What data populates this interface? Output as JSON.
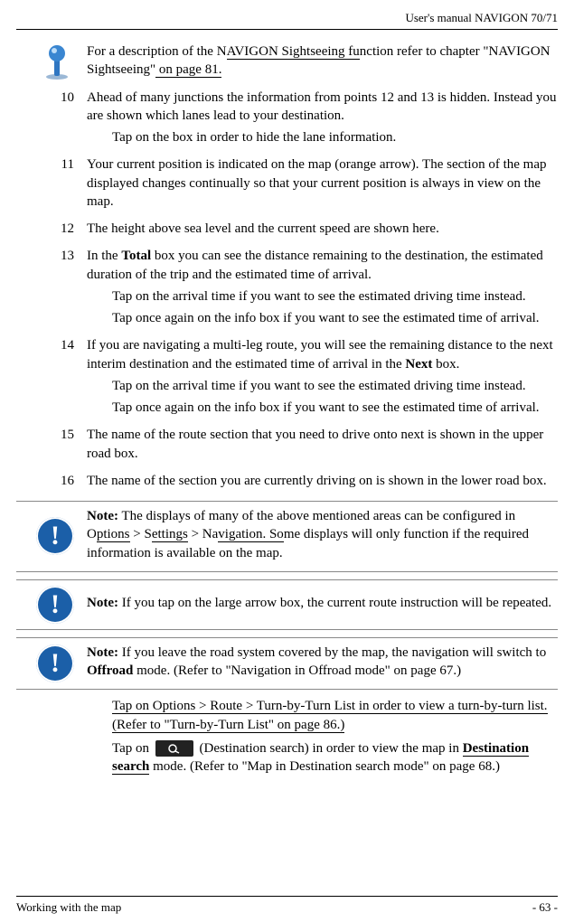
{
  "header": {
    "title": "User's manual NAVIGON 70/71"
  },
  "intro": {
    "p1a": "For a description of the N",
    "p1link": "AVIGON Sightseeing fu",
    "p1b": "nction refer to chapter \"NAVIGON Sightseeing\"",
    "p1page": " on page 81."
  },
  "items": {
    "i10": {
      "num": "10",
      "p1": "Ahead of many junctions the information from points 12 and 13 is hidden. Instead you are shown which lanes lead to your destination.",
      "sub1": "Tap on the box in order to hide the lane information."
    },
    "i11": {
      "num": "11",
      "p1": "Your current position is indicated on the map (orange arrow). The section of the map displayed changes continually so that your current position is always in view on the map."
    },
    "i12": {
      "num": "12",
      "p1": "The height above sea level and the current speed are shown here."
    },
    "i13": {
      "num": "13",
      "p1a": "In the ",
      "p1bold": "Total",
      "p1b": " box you can see the distance remaining to the destination, the estimated duration of the trip and the estimated time of arrival.",
      "sub1": "Tap on the arrival time if you want to see the estimated driving time instead.",
      "sub2": "Tap once again on the info box if you want to see the estimated time of arrival."
    },
    "i14": {
      "num": "14",
      "p1a": "If you are navigating a multi-leg route, you will see the remaining distance to the next interim destination and the estimated time of arrival in the ",
      "p1bold": "Next",
      "p1b": " box.",
      "sub1": "Tap on the arrival time if you want to see the estimated driving time instead.",
      "sub2": "Tap once again on the info box if you want to see the estimated time of arrival."
    },
    "i15": {
      "num": "15",
      "p1": "The name of the route section that you need to drive onto next is shown in the upper road box."
    },
    "i16": {
      "num": "16",
      "p1": "The name of the section you are currently driving on is shown in the lower road box."
    }
  },
  "notes": {
    "n1": {
      "lead": "Note:",
      "a": " The displays of many of the above mentioned areas can be configured in O",
      "link1": "ptions",
      "b": " > S",
      "link2": "ettings",
      "c": " > Na",
      "link3": "vigation. So",
      "d": "me displays will only function if the required information is available on the map."
    },
    "n2": {
      "lead": "Note:",
      "body": " If you tap on the large arrow box, the current route instruction will be repeated."
    },
    "n3": {
      "lead": "Note:",
      "a": " If you leave the road system covered by the map, the navigation will switch to ",
      "bold": "Offroad",
      "b": " mode. (Refer to \"Navigation in Offroad mode\" on page 67.)"
    }
  },
  "trail": {
    "p1a": "Tap on Options > Route > Turn-by-Turn List in order to view a turn-by-turn list. (Refer to \"Turn-by-Turn List\" on page 86.)",
    "p2a": "Tap on ",
    "p2b": " (Destination search) in order to view the map in ",
    "p2bold": "Destination search",
    "p2c": " mode. (Refer to \"Map in Destination search mode\" on page 68.)"
  },
  "footer": {
    "left": "Working with the map",
    "right": "- 63 -"
  }
}
